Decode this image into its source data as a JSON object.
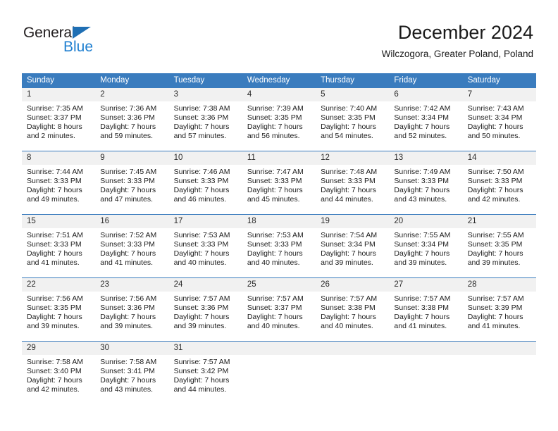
{
  "brand": {
    "name_part1": "General",
    "name_part2": "Blue"
  },
  "header": {
    "title": "December 2024",
    "location": "Wilczogora, Greater Poland, Poland"
  },
  "colors": {
    "header_blue": "#3a7cbe",
    "logo_blue": "#1f7fd0",
    "daynum_bg": "#f1f1f1"
  },
  "weekdays": [
    "Sunday",
    "Monday",
    "Tuesday",
    "Wednesday",
    "Thursday",
    "Friday",
    "Saturday"
  ],
  "weeks": [
    [
      {
        "day": "1",
        "sunrise": "Sunrise: 7:35 AM",
        "sunset": "Sunset: 3:37 PM",
        "daylight1": "Daylight: 8 hours",
        "daylight2": "and 2 minutes."
      },
      {
        "day": "2",
        "sunrise": "Sunrise: 7:36 AM",
        "sunset": "Sunset: 3:36 PM",
        "daylight1": "Daylight: 7 hours",
        "daylight2": "and 59 minutes."
      },
      {
        "day": "3",
        "sunrise": "Sunrise: 7:38 AM",
        "sunset": "Sunset: 3:36 PM",
        "daylight1": "Daylight: 7 hours",
        "daylight2": "and 57 minutes."
      },
      {
        "day": "4",
        "sunrise": "Sunrise: 7:39 AM",
        "sunset": "Sunset: 3:35 PM",
        "daylight1": "Daylight: 7 hours",
        "daylight2": "and 56 minutes."
      },
      {
        "day": "5",
        "sunrise": "Sunrise: 7:40 AM",
        "sunset": "Sunset: 3:35 PM",
        "daylight1": "Daylight: 7 hours",
        "daylight2": "and 54 minutes."
      },
      {
        "day": "6",
        "sunrise": "Sunrise: 7:42 AM",
        "sunset": "Sunset: 3:34 PM",
        "daylight1": "Daylight: 7 hours",
        "daylight2": "and 52 minutes."
      },
      {
        "day": "7",
        "sunrise": "Sunrise: 7:43 AM",
        "sunset": "Sunset: 3:34 PM",
        "daylight1": "Daylight: 7 hours",
        "daylight2": "and 50 minutes."
      }
    ],
    [
      {
        "day": "8",
        "sunrise": "Sunrise: 7:44 AM",
        "sunset": "Sunset: 3:33 PM",
        "daylight1": "Daylight: 7 hours",
        "daylight2": "and 49 minutes."
      },
      {
        "day": "9",
        "sunrise": "Sunrise: 7:45 AM",
        "sunset": "Sunset: 3:33 PM",
        "daylight1": "Daylight: 7 hours",
        "daylight2": "and 47 minutes."
      },
      {
        "day": "10",
        "sunrise": "Sunrise: 7:46 AM",
        "sunset": "Sunset: 3:33 PM",
        "daylight1": "Daylight: 7 hours",
        "daylight2": "and 46 minutes."
      },
      {
        "day": "11",
        "sunrise": "Sunrise: 7:47 AM",
        "sunset": "Sunset: 3:33 PM",
        "daylight1": "Daylight: 7 hours",
        "daylight2": "and 45 minutes."
      },
      {
        "day": "12",
        "sunrise": "Sunrise: 7:48 AM",
        "sunset": "Sunset: 3:33 PM",
        "daylight1": "Daylight: 7 hours",
        "daylight2": "and 44 minutes."
      },
      {
        "day": "13",
        "sunrise": "Sunrise: 7:49 AM",
        "sunset": "Sunset: 3:33 PM",
        "daylight1": "Daylight: 7 hours",
        "daylight2": "and 43 minutes."
      },
      {
        "day": "14",
        "sunrise": "Sunrise: 7:50 AM",
        "sunset": "Sunset: 3:33 PM",
        "daylight1": "Daylight: 7 hours",
        "daylight2": "and 42 minutes."
      }
    ],
    [
      {
        "day": "15",
        "sunrise": "Sunrise: 7:51 AM",
        "sunset": "Sunset: 3:33 PM",
        "daylight1": "Daylight: 7 hours",
        "daylight2": "and 41 minutes."
      },
      {
        "day": "16",
        "sunrise": "Sunrise: 7:52 AM",
        "sunset": "Sunset: 3:33 PM",
        "daylight1": "Daylight: 7 hours",
        "daylight2": "and 41 minutes."
      },
      {
        "day": "17",
        "sunrise": "Sunrise: 7:53 AM",
        "sunset": "Sunset: 3:33 PM",
        "daylight1": "Daylight: 7 hours",
        "daylight2": "and 40 minutes."
      },
      {
        "day": "18",
        "sunrise": "Sunrise: 7:53 AM",
        "sunset": "Sunset: 3:33 PM",
        "daylight1": "Daylight: 7 hours",
        "daylight2": "and 40 minutes."
      },
      {
        "day": "19",
        "sunrise": "Sunrise: 7:54 AM",
        "sunset": "Sunset: 3:34 PM",
        "daylight1": "Daylight: 7 hours",
        "daylight2": "and 39 minutes."
      },
      {
        "day": "20",
        "sunrise": "Sunrise: 7:55 AM",
        "sunset": "Sunset: 3:34 PM",
        "daylight1": "Daylight: 7 hours",
        "daylight2": "and 39 minutes."
      },
      {
        "day": "21",
        "sunrise": "Sunrise: 7:55 AM",
        "sunset": "Sunset: 3:35 PM",
        "daylight1": "Daylight: 7 hours",
        "daylight2": "and 39 minutes."
      }
    ],
    [
      {
        "day": "22",
        "sunrise": "Sunrise: 7:56 AM",
        "sunset": "Sunset: 3:35 PM",
        "daylight1": "Daylight: 7 hours",
        "daylight2": "and 39 minutes."
      },
      {
        "day": "23",
        "sunrise": "Sunrise: 7:56 AM",
        "sunset": "Sunset: 3:36 PM",
        "daylight1": "Daylight: 7 hours",
        "daylight2": "and 39 minutes."
      },
      {
        "day": "24",
        "sunrise": "Sunrise: 7:57 AM",
        "sunset": "Sunset: 3:36 PM",
        "daylight1": "Daylight: 7 hours",
        "daylight2": "and 39 minutes."
      },
      {
        "day": "25",
        "sunrise": "Sunrise: 7:57 AM",
        "sunset": "Sunset: 3:37 PM",
        "daylight1": "Daylight: 7 hours",
        "daylight2": "and 40 minutes."
      },
      {
        "day": "26",
        "sunrise": "Sunrise: 7:57 AM",
        "sunset": "Sunset: 3:38 PM",
        "daylight1": "Daylight: 7 hours",
        "daylight2": "and 40 minutes."
      },
      {
        "day": "27",
        "sunrise": "Sunrise: 7:57 AM",
        "sunset": "Sunset: 3:38 PM",
        "daylight1": "Daylight: 7 hours",
        "daylight2": "and 41 minutes."
      },
      {
        "day": "28",
        "sunrise": "Sunrise: 7:57 AM",
        "sunset": "Sunset: 3:39 PM",
        "daylight1": "Daylight: 7 hours",
        "daylight2": "and 41 minutes."
      }
    ],
    [
      {
        "day": "29",
        "sunrise": "Sunrise: 7:58 AM",
        "sunset": "Sunset: 3:40 PM",
        "daylight1": "Daylight: 7 hours",
        "daylight2": "and 42 minutes."
      },
      {
        "day": "30",
        "sunrise": "Sunrise: 7:58 AM",
        "sunset": "Sunset: 3:41 PM",
        "daylight1": "Daylight: 7 hours",
        "daylight2": "and 43 minutes."
      },
      {
        "day": "31",
        "sunrise": "Sunrise: 7:57 AM",
        "sunset": "Sunset: 3:42 PM",
        "daylight1": "Daylight: 7 hours",
        "daylight2": "and 44 minutes."
      },
      {
        "day": "",
        "sunrise": "",
        "sunset": "",
        "daylight1": "",
        "daylight2": ""
      },
      {
        "day": "",
        "sunrise": "",
        "sunset": "",
        "daylight1": "",
        "daylight2": ""
      },
      {
        "day": "",
        "sunrise": "",
        "sunset": "",
        "daylight1": "",
        "daylight2": ""
      },
      {
        "day": "",
        "sunrise": "",
        "sunset": "",
        "daylight1": "",
        "daylight2": ""
      }
    ]
  ]
}
